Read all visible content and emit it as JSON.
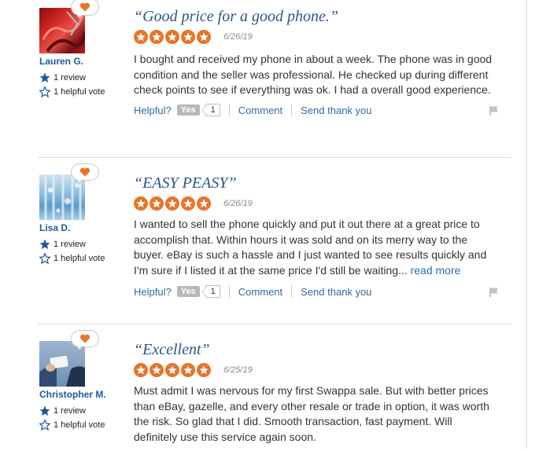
{
  "colors": {
    "accent": "#e8742a",
    "link": "#2f6aa6",
    "title": "#2a5587",
    "name": "#1f5a96"
  },
  "reviews": [
    {
      "title": "“Good price for a good phone.”",
      "date": "6/26/19",
      "rating": 5,
      "reviewer": "Lauren G.",
      "reviews_count": "1 review",
      "helpful_votes": "1 helpful vote",
      "body": "I bought and received my phone in about a week. The phone was in good condition and the seller was professional. He checked up during different check points to see if everything was ok. I had a overall good experience.",
      "read_more": "",
      "helpful_label": "Helpful?",
      "yes_label": "Yes",
      "yes_count": "1",
      "comment_label": "Comment",
      "thanks_label": "Send thank you"
    },
    {
      "title": "“EASY PEASY”",
      "date": "6/26/19",
      "rating": 5,
      "reviewer": "Lisa D.",
      "reviews_count": "1 review",
      "helpful_votes": "1 helpful vote",
      "body": "I wanted to sell the phone quickly and put it out there at a great price to accomplish that. Within hours it was sold and on its merry way to the buyer. eBay is such a hassle and I just wanted to see results quickly and I'm sure if I listed it at the same price I'd still be waiting...",
      "read_more": "read more",
      "helpful_label": "Helpful?",
      "yes_label": "Yes",
      "yes_count": "1",
      "comment_label": "Comment",
      "thanks_label": "Send thank you"
    },
    {
      "title": "“Excellent”",
      "date": "6/25/19",
      "rating": 5,
      "reviewer": "Christopher M.",
      "reviews_count": "1 review",
      "helpful_votes": "1 helpful vote",
      "body": "Must admit I was nervous for my first Swappa sale. But with better prices than eBay, gazelle, and every other resale or trade in option, it was worth the risk. So glad that I did. Smooth transaction, fast payment. Will definitely use this service again soon.",
      "read_more": "",
      "helpful_label": "",
      "yes_label": "",
      "yes_count": "",
      "comment_label": "",
      "thanks_label": ""
    }
  ]
}
